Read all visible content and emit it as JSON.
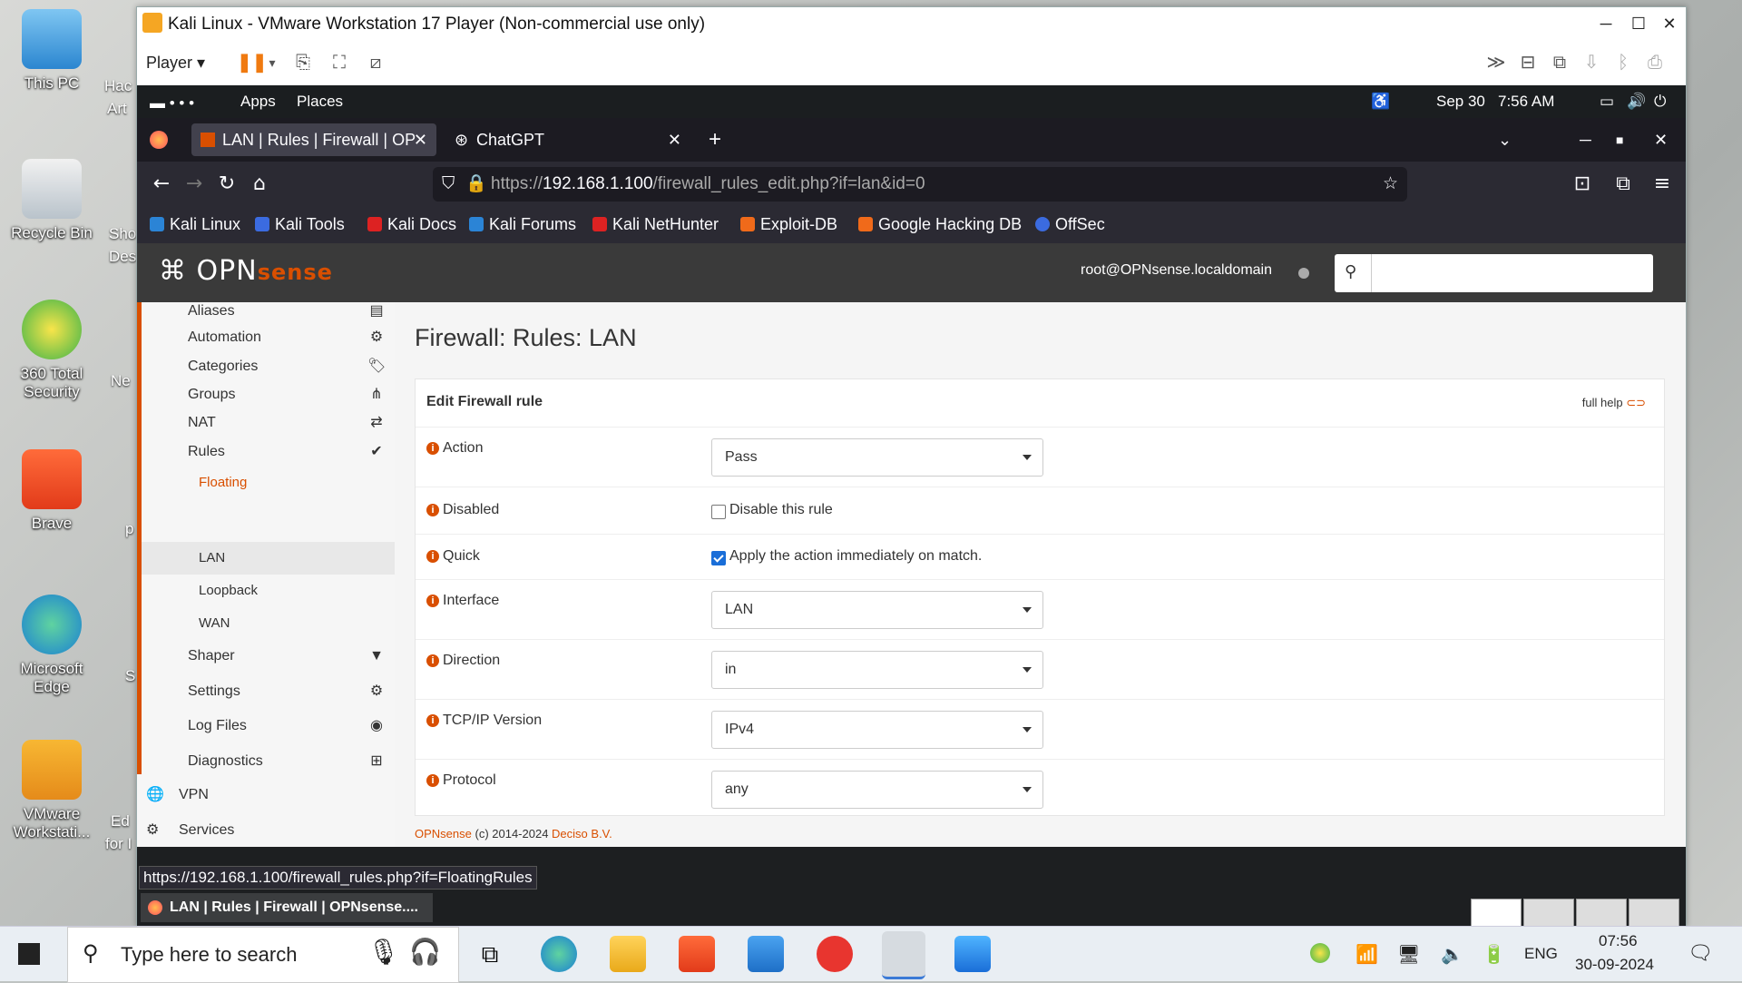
{
  "desktop": {
    "icons": [
      "This PC",
      "Recycle Bin",
      "360 Total Security",
      "Brave",
      "Microsoft Edge",
      "VMware Workstati..."
    ],
    "partial_labels": [
      "Hac",
      "Art",
      "Sho",
      "Des",
      "Ne",
      "p",
      "S",
      "Ed",
      "for I"
    ]
  },
  "vmware": {
    "title": "Kali Linux - VMware Workstation 17 Player (Non-commercial use only)",
    "player_menu": "Player",
    "win_min": "─",
    "win_max": "☐",
    "win_close": "✕"
  },
  "kali": {
    "apps": "Apps",
    "places": "Places",
    "date": "Sep 30",
    "time": "7:56 AM"
  },
  "firefox": {
    "tabs": [
      {
        "title": "LAN | Rules | Firewall | OP",
        "active": true
      },
      {
        "title": "ChatGPT",
        "active": false
      }
    ],
    "url_prefix": "https://",
    "url_host": "192.168.1.100",
    "url_path": "/firewall_rules_edit.php?if=lan&id=0",
    "bookmarks": [
      "Kali Linux",
      "Kali Tools",
      "Kali Docs",
      "Kali Forums",
      "Kali NetHunter",
      "Exploit-DB",
      "Google Hacking DB",
      "OffSec"
    ],
    "status_url": "https://192.168.1.100/firewall_rules.php?if=FloatingRules"
  },
  "opnsense": {
    "logo_a": "OPN",
    "logo_b": "sense",
    "user": "root@OPNsense.localdomain",
    "sidebar": {
      "items": [
        "Aliases",
        "Automation",
        "Categories",
        "Groups",
        "NAT",
        "Rules",
        "Shaper",
        "Settings",
        "Log Files",
        "Diagnostics"
      ],
      "rules_sub": [
        "Floating",
        "LAN",
        "Loopback",
        "WAN"
      ],
      "top_level": [
        "VPN",
        "Services"
      ]
    },
    "page_title": "Firewall: Rules: LAN",
    "card_title": "Edit Firewall rule",
    "full_help": "full help",
    "fields": {
      "action_label": "Action",
      "action_value": "Pass",
      "disabled_label": "Disabled",
      "disabled_text": "Disable this rule",
      "quick_label": "Quick",
      "quick_text": "Apply the action immediately on match.",
      "interface_label": "Interface",
      "interface_value": "LAN",
      "direction_label": "Direction",
      "direction_value": "in",
      "tcpip_label": "TCP/IP Version",
      "tcpip_value": "IPv4",
      "protocol_label": "Protocol",
      "protocol_value": "any"
    },
    "footer_a": "OPNsense",
    "footer_b": " (c) 2014-2024 ",
    "footer_c": "Deciso B.V."
  },
  "guest_taskbar": {
    "item": "LAN | Rules | Firewall | OPNsense...."
  },
  "windows_taskbar": {
    "search_placeholder": "Type here to search",
    "lang": "ENG",
    "time": "07:56",
    "date": "30-09-2024"
  },
  "colors": {
    "opn_accent": "#d94f00",
    "firefox_dark": "#1c1b22",
    "kali_dark": "#1b1e20"
  }
}
